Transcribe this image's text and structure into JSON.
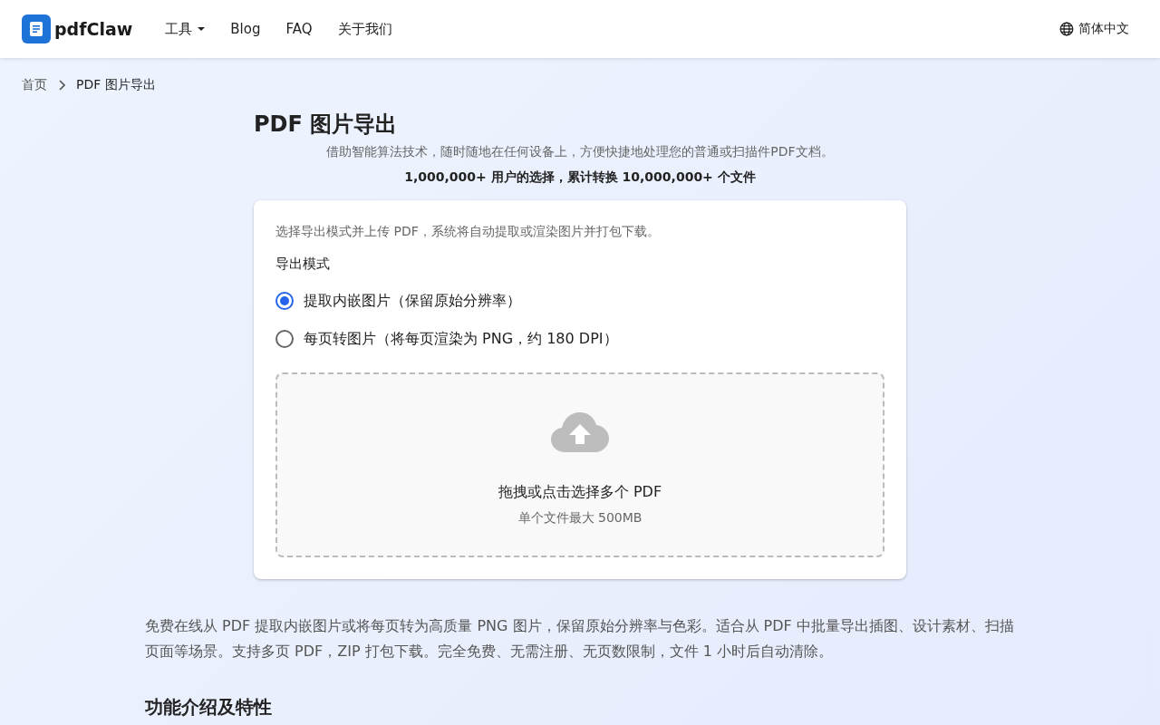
{
  "header": {
    "logo": "pdfClaw",
    "nav": [
      {
        "label": "工具",
        "kind": "dropdown"
      },
      {
        "label": "Blog",
        "kind": "link"
      },
      {
        "label": "FAQ",
        "kind": "link"
      },
      {
        "label": "关于我们",
        "kind": "link"
      }
    ],
    "language": "简体中文"
  },
  "breadcrumb": [
    "首页",
    "PDF 图片导出"
  ],
  "title": "PDF 图片导出",
  "subtitle": "借助智能算法技术，随时随地在任何设备上，方便快捷地处理您的普通或扫描件PDF文档。",
  "stats": "1,000,000+ 用户的选择，累计转换 10,000,000+ 个文件",
  "card": {
    "hint": "选择导出模式并上传 PDF，系统将自动提取或渲染图片并打包下载。",
    "mode_label": "导出模式",
    "modes": [
      {
        "label": "提取内嵌图片（保留原始分辨率）",
        "selected": true
      },
      {
        "label": "每页转图片（将每页渲染为 PNG，约 180 DPI）",
        "selected": false
      }
    ],
    "dropzone": {
      "title": "拖拽或点击选择多个 PDF",
      "note": "单个文件最大 500MB"
    }
  },
  "description": "免费在线从 PDF 提取内嵌图片或将每页转为高质量 PNG 图片，保留原始分辨率与色彩。适合从 PDF 中批量导出插图、设计素材、扫描页面等场景。支持多页 PDF，ZIP 打包下载。完全免费、无需注册、无页数限制，文件 1 小时后自动清除。",
  "section_heading": "功能介绍及特性"
}
